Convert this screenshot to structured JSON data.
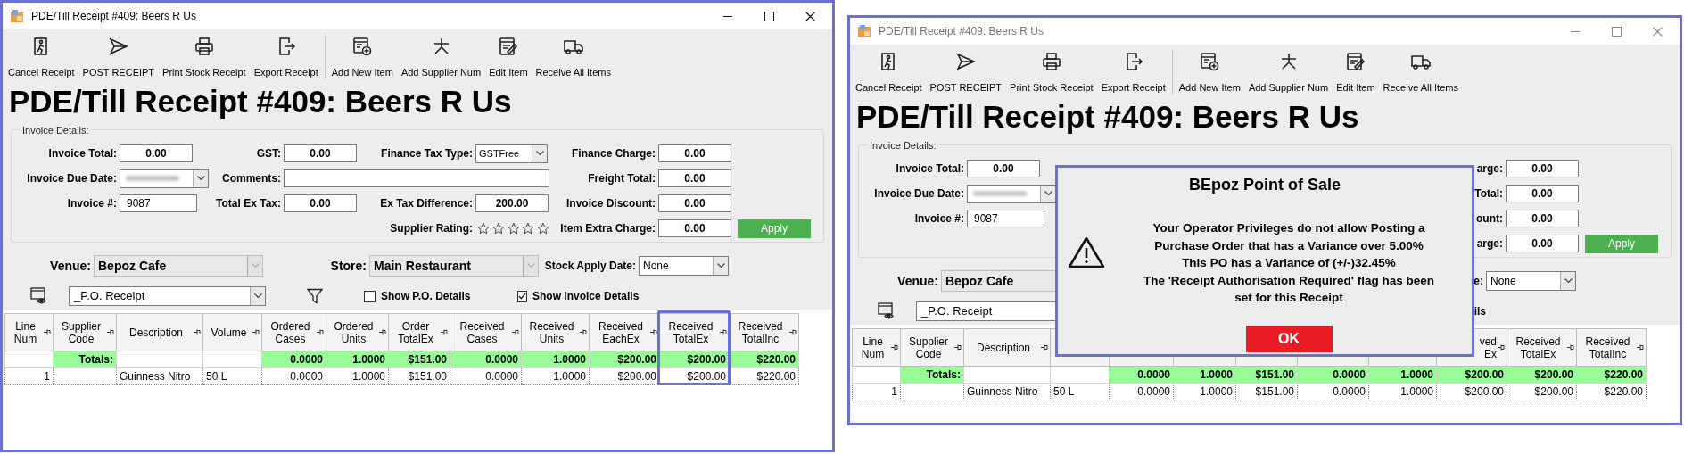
{
  "windows": [
    {
      "title": "PDE/Till Receipt #409: Beers R Us",
      "active": true,
      "toolbar_groups": [
        [
          {
            "kind": "cancel",
            "label": "Cancel Receipt"
          },
          {
            "kind": "send",
            "label": "POST RECEIPT"
          },
          {
            "kind": "print",
            "label": "Print Stock Receipt"
          },
          {
            "kind": "export",
            "label": "Export Receipt"
          }
        ],
        [
          {
            "kind": "add",
            "label": "Add New Item"
          },
          {
            "kind": "asterisk",
            "label": "Add Supplier Num"
          },
          {
            "kind": "edit",
            "label": "Edit Item"
          },
          {
            "kind": "truck",
            "label": "Receive All Items"
          }
        ]
      ],
      "heading": "PDE/Till Receipt #409: Beers R Us",
      "invoice_details": {
        "legend": "Invoice Details:",
        "rows": [
          [
            {
              "kind": "field",
              "label": "Invoice Total:",
              "value": "0.00"
            },
            {
              "kind": "field",
              "label": "GST:",
              "value": "0.00"
            },
            {
              "kind": "select",
              "label": "Finance Tax Type:",
              "value": "GSTFree"
            },
            {
              "kind": "field",
              "label": "Finance Charge:",
              "value": "0.00"
            }
          ],
          [
            {
              "kind": "date",
              "label": "Invoice Due Date:"
            },
            {
              "kind": "wide_field",
              "label": "Comments:"
            },
            "",
            {
              "kind": "field",
              "label": "Freight Total:",
              "value": "0.00"
            }
          ],
          [
            {
              "kind": "text_field",
              "label": "Invoice #:",
              "value": "9087"
            },
            {
              "kind": "field",
              "label": "Total Ex Tax:",
              "value": "0.00"
            },
            {
              "kind": "field",
              "label": "Ex Tax Difference:",
              "value": "200.00"
            },
            {
              "kind": "field",
              "label": "Invoice Discount:",
              "value": "0.00"
            }
          ],
          [
            null,
            null,
            {
              "kind": "rating",
              "label": "Supplier Rating:",
              "stars": 0
            },
            {
              "kind": "field",
              "label": "Item Extra Charge:",
              "value": "0.00"
            }
          ]
        ],
        "apply_button": "Apply"
      },
      "venue_row": {
        "venue": {
          "kind": "location",
          "label": "Venue:",
          "value": "Bepoz Cafe",
          "disabled": true
        },
        "store": {
          "kind": "location",
          "label": "Store:",
          "value": "Main Restaurant",
          "disabled": true
        },
        "stock_apply_date": {
          "kind": "date_select",
          "label": "Stock Apply Date:",
          "value": "None",
          "disabled": false
        }
      },
      "view_row": {
        "layout_select": {
          "value": "_P.O. Receipt"
        },
        "filter": {
          "kind": "funnel"
        },
        "show_po_details": {
          "kind": "checkbox",
          "label": "Show P.O. Details",
          "checked": false
        },
        "show_invoice_details": {
          "kind": "checkbox",
          "label": "Show Invoice Details",
          "checked": true
        }
      },
      "table": {
        "columns": [
          {
            "label": "Line\nNum",
            "highlighted": false
          },
          {
            "label": "Supplier\nCode",
            "highlighted": false
          },
          {
            "label": "Description",
            "highlighted": false
          },
          {
            "label": "Volume",
            "highlighted": false
          },
          {
            "label": "Ordered\nCases",
            "highlighted": false
          },
          {
            "label": "Ordered\nUnits",
            "highlighted": false
          },
          {
            "label": "Order\nTotalEx",
            "highlighted": false
          },
          {
            "label": "Received\nCases",
            "highlighted": false
          },
          {
            "label": "Received\nUnits",
            "highlighted": false
          },
          {
            "label": "Received\nEachEx",
            "highlighted": false
          },
          {
            "label": "Received\nTotalEx",
            "highlighted": true
          },
          {
            "label": "Received\nTotalInc",
            "highlighted": false
          }
        ],
        "rows": [
          {
            "kind": "totals",
            "cells": [
              null,
              "Totals:",
              null,
              null,
              "0.0000",
              "1.0000",
              "$151.00",
              "0.0000",
              "1.0000",
              "$200.00",
              "$200.00",
              "$220.00"
            ]
          },
          {
            "kind": "item",
            "cells": [
              "1",
              null,
              "Guinness Nitro",
              "50 L",
              "0.0000",
              "1.0000",
              "$151.00",
              "0.0000",
              "1.0000",
              "$200.00",
              "$200.00",
              "$220.00"
            ]
          }
        ]
      }
    },
    {
      "title": "PDE/Till Receipt #409: Beers R Us",
      "active": false,
      "toolbar_groups": [
        [
          {
            "kind": "cancel",
            "label": "Cancel Receipt"
          },
          {
            "kind": "send",
            "label": "POST RECEIPT"
          },
          {
            "kind": "print",
            "label": "Print Stock Receipt"
          },
          {
            "kind": "export",
            "label": "Export Receipt"
          }
        ],
        [
          {
            "kind": "add",
            "label": "Add New Item"
          },
          {
            "kind": "asterisk",
            "label": "Add Supplier Num"
          },
          {
            "kind": "edit",
            "label": "Edit Item"
          },
          {
            "kind": "truck",
            "label": "Receive All Items"
          }
        ]
      ],
      "heading": "PDE/Till Receipt #409: Beers R Us",
      "invoice_details": {
        "legend": "Invoice Details:",
        "rows": [
          [
            {
              "kind": "field",
              "label": "Invoice Total:",
              "value": "0.00"
            },
            null,
            null,
            {
              "kind": "field",
              "label": "arge:",
              "value": "0.00"
            }
          ],
          [
            {
              "kind": "date",
              "label": "Invoice Due Date:"
            },
            null,
            null,
            {
              "kind": "field",
              "label": "Total:",
              "value": "0.00"
            }
          ],
          [
            {
              "kind": "text_field",
              "label": "Invoice #:",
              "value": "9087"
            },
            null,
            null,
            {
              "kind": "field",
              "label": "ount:",
              "value": "0.00"
            }
          ],
          [
            null,
            null,
            null,
            {
              "kind": "field",
              "label": "arge:",
              "value": "0.00"
            }
          ]
        ],
        "apply_button": "Apply"
      },
      "venue_row": {
        "venue": {
          "kind": "location",
          "label": "Venue:",
          "value": "Bepoz Cafe",
          "disabled": true,
          "clipped": true
        },
        "stock_apply_date": {
          "kind": "date_select",
          "label": "e:",
          "value": "None",
          "disabled": false
        }
      },
      "view_row": {
        "layout_select": {
          "value": "_P.O. Receipt",
          "clipped": true
        },
        "show_invoice_details": {
          "kind": "clipped",
          "label": "ils"
        }
      },
      "table": {
        "columns": [
          {
            "label": "Line\nNum",
            "highlighted": false
          },
          {
            "label": "Supplier\nCode",
            "highlighted": false
          },
          {
            "label": "Description",
            "highlighted": false
          },
          null,
          null,
          null,
          null,
          null,
          null,
          {
            "label": "ved\nEx",
            "highlighted": false,
            "clipped": true
          },
          {
            "label": "Received\nTotalEx",
            "highlighted": false
          },
          {
            "label": "Received\nTotalInc",
            "highlighted": false
          }
        ],
        "rows": [
          {
            "kind": "totals",
            "cells": [
              null,
              "Totals:",
              null,
              null,
              "0.0000",
              "1.0000",
              "$151.00",
              "0.0000",
              "1.0000",
              "$200.00",
              "$200.00",
              "$220.00"
            ]
          },
          {
            "kind": "item",
            "cells": [
              "1",
              null,
              "Guinness Nitro",
              "50 L",
              "0.0000",
              "1.0000",
              "$151.00",
              "0.0000",
              "1.0000",
              "$200.00",
              "$200.00",
              "$220.00"
            ]
          }
        ]
      }
    }
  ],
  "dialog": {
    "title": "BEpoz Point of Sale",
    "message": "Your Operator Privileges do not allow Posting a\nPurchase Order that has a Variance over 5.00%\nThis PO has a Variance of (+/-)32.45%\nThe 'Receipt Authorisation Required' flag has been\nset for this Receipt",
    "button": "OK"
  }
}
